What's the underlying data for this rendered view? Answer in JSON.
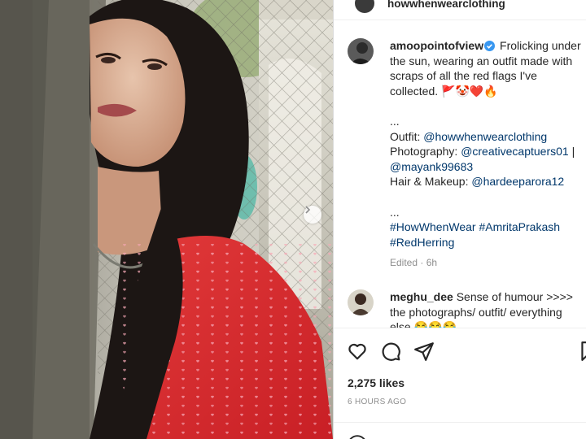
{
  "header": {
    "username": "howwhenwearclothing"
  },
  "caption": {
    "username": "amoopointofview",
    "text": "Frolicking under the sun, wearing an outfit made with scraps of all the red flags I've collected.",
    "emojis": "🚩🤡❤️🔥",
    "dots1": "...",
    "outfit_label": "Outfit:",
    "outfit_link": "@howwhenwearclothing",
    "photo_label": "Photography:",
    "photo_link1": "@creativecaptuers01",
    "photo_sep": "|",
    "photo_link2": "@mayank99683",
    "hair_label": "Hair & Makeup:",
    "hair_link": "@hardeeparora12",
    "dots2": "...",
    "hashtags": "#HowWhenWear #AmritaPrakash #RedHerring",
    "edited": "Edited · 6h"
  },
  "comment": {
    "username": "meghu_dee",
    "text": "Sense of humour >>>> the photographs/ outfit/ everything else",
    "emojis": "😂😂😂"
  },
  "post": {
    "likes": "2,275 likes",
    "time": "6 HOURS AGO"
  },
  "icons": {
    "like": "heart-icon",
    "comment": "comment-bubble-icon",
    "share": "paper-plane-icon",
    "save": "bookmark-icon",
    "verified": "verified-badge-icon",
    "next": "chevron-right-icon"
  },
  "colors": {
    "link": "#00376b",
    "verified": "#3897f0",
    "text": "#262626",
    "muted": "#8e8e8e"
  }
}
